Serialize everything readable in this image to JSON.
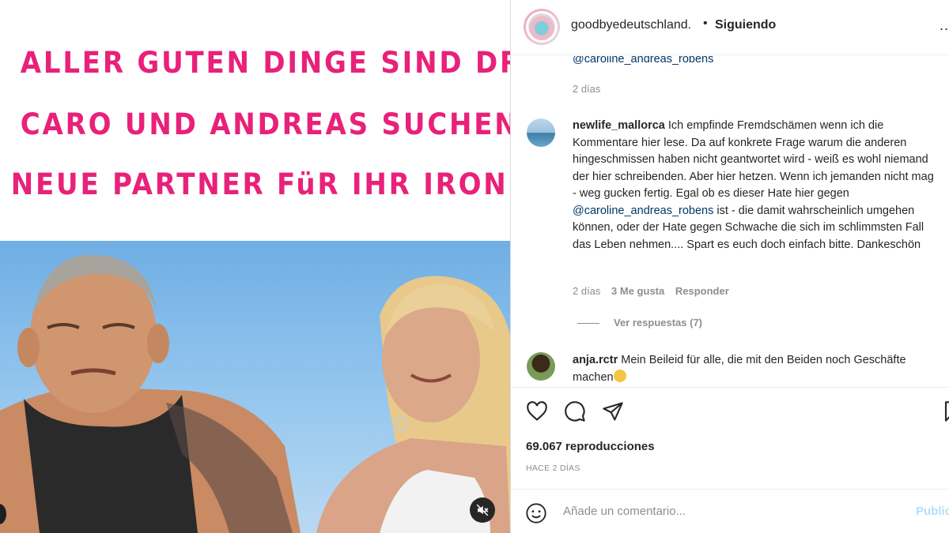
{
  "media": {
    "title_lines": [
      "ALLER GUTEN DINGE SIND DREI!?",
      "CARO UND ANDREAS SUCHEN",
      "NEUE PARTNER FüR IHR IRON DINER"
    ],
    "title_color": "#e8217a",
    "mute_icon": "speaker-muted-icon"
  },
  "header": {
    "username": "goodbyedeutschland.",
    "separator": "•",
    "follow_label": "Siguiendo",
    "more_label": "..."
  },
  "comments": {
    "prev_mention": "@caroline_andreas_robens",
    "prev_time": "2 días",
    "items": [
      {
        "username": "newlife_mallorca",
        "text_before": "Ich empfinde Fremdschämen wenn ich die Kommentare hier lese. Da auf konkrete Frage warum die anderen hingeschmissen haben nicht geantwortet wird - weiß es wohl niemand der hier schreibenden. Aber hier hetzen. Wenn ich jemanden nicht mag - weg gucken fertig. Egal ob es dieser Hate hier gegen ",
        "mention": "@caroline_andreas_robens",
        "text_after": " ist - die damit wahrscheinlich umgehen können, oder der Hate gegen Schwache die sich im schlimmsten Fall das Leben nehmen.... Spart es euch doch einfach bitte. Dankeschön",
        "time": "2 días",
        "likes": "3 Me gusta",
        "reply": "Responder",
        "view_replies": "Ver respuestas (7)"
      },
      {
        "username": "anja.rctr",
        "text": "Mein Beileid für alle, die mit den Beiden noch Geschäfte machen"
      }
    ]
  },
  "actions": {
    "icons": [
      "heart-icon",
      "comment-icon",
      "share-icon",
      "bookmark-icon"
    ],
    "views": "69.067 reproducciones",
    "ago": "HACE 2 DÍAS"
  },
  "add_comment": {
    "placeholder": "Añade un comentario...",
    "publish": "Publicar"
  }
}
